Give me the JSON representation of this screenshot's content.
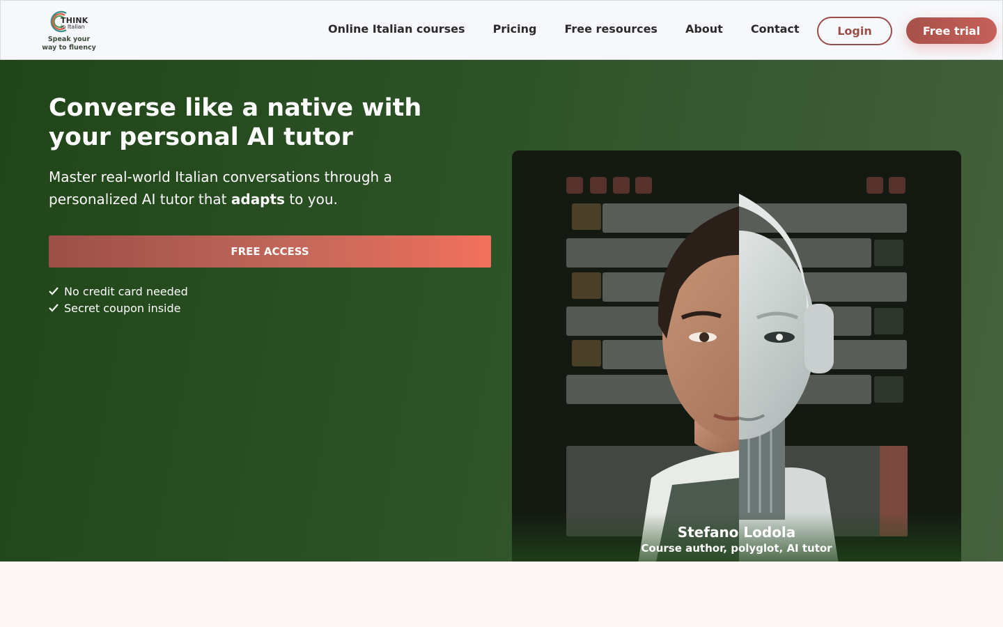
{
  "brand": {
    "logo_text": "THINK",
    "logo_sub": "in Italian",
    "tagline": "Speak your way to fluency"
  },
  "nav": {
    "items": [
      {
        "label": "Online Italian courses"
      },
      {
        "label": "Pricing"
      },
      {
        "label": "Free resources"
      },
      {
        "label": "About"
      },
      {
        "label": "Contact"
      }
    ]
  },
  "actions": {
    "login_label": "Login",
    "trial_label": "Free trial"
  },
  "hero": {
    "title": "Converse like a native with your personal AI tutor",
    "subtitle_pre": "Master real-world Italian conversations through a personalized AI tutor that ",
    "subtitle_bold": "adapts",
    "subtitle_post": " to you.",
    "cta_label": "FREE ACCESS",
    "checks": [
      {
        "text": "No credit card needed"
      },
      {
        "text": "Secret coupon inside"
      }
    ]
  },
  "tutor": {
    "name": "Stefano Lodola",
    "role": "Course author, polyglot, AI tutor"
  },
  "colors": {
    "accent": "#a75149",
    "hero_bg": "#2d5227",
    "cta_end": "#f2705c"
  },
  "icons": [
    "check-icon",
    "microphone-icon",
    "settings-icon",
    "power-icon"
  ]
}
